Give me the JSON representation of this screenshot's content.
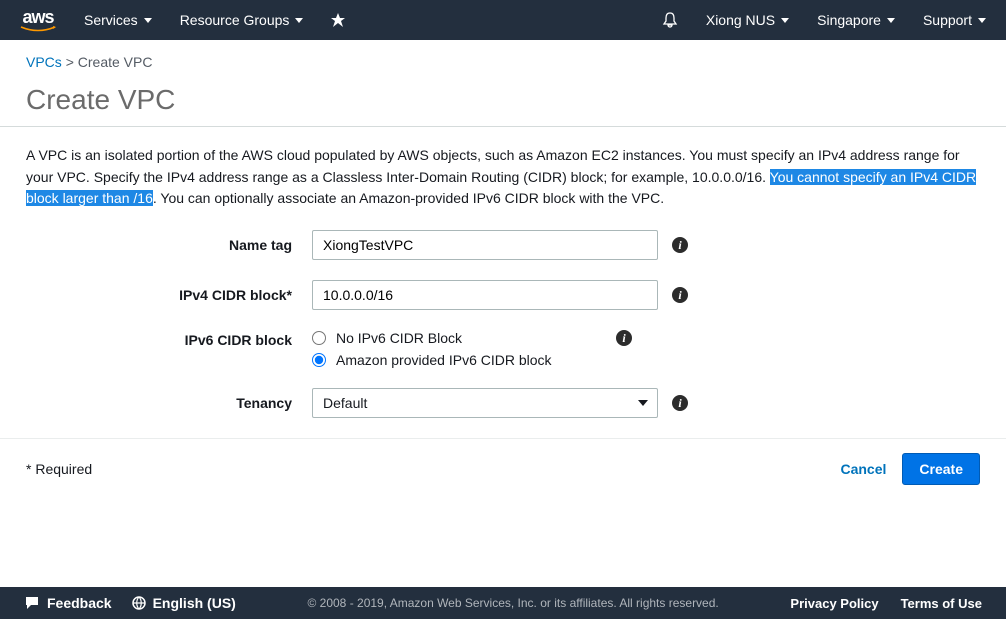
{
  "nav": {
    "services": "Services",
    "resource_groups": "Resource Groups",
    "account": "Xiong NUS",
    "region": "Singapore",
    "support": "Support"
  },
  "breadcrumb": {
    "link": "VPCs",
    "sep": ">",
    "current": "Create VPC"
  },
  "title": "Create VPC",
  "desc": {
    "part1": "A VPC is an isolated portion of the AWS cloud populated by AWS objects, such as Amazon EC2 instances. You must specify an IPv4 address range for your VPC. Specify the IPv4 address range as a Classless Inter-Domain Routing (CIDR) block; for example, 10.0.0.0/16. ",
    "highlight": "You cannot specify an IPv4 CIDR block larger than /16",
    "part2": ". You can optionally associate an Amazon-provided IPv6 CIDR block with the VPC."
  },
  "form": {
    "name_tag_label": "Name tag",
    "name_tag_value": "XiongTestVPC",
    "ipv4_label": "IPv4 CIDR block*",
    "ipv4_value": "10.0.0.0/16",
    "ipv6_label": "IPv6 CIDR block",
    "ipv6_opt1": "No IPv6 CIDR Block",
    "ipv6_opt2": "Amazon provided IPv6 CIDR block",
    "tenancy_label": "Tenancy",
    "tenancy_value": "Default"
  },
  "required": "* Required",
  "buttons": {
    "cancel": "Cancel",
    "create": "Create"
  },
  "footer": {
    "feedback": "Feedback",
    "language": "English (US)",
    "copyright": "© 2008 - 2019, Amazon Web Services, Inc. or its affiliates. All rights reserved.",
    "privacy": "Privacy Policy",
    "terms": "Terms of Use"
  }
}
